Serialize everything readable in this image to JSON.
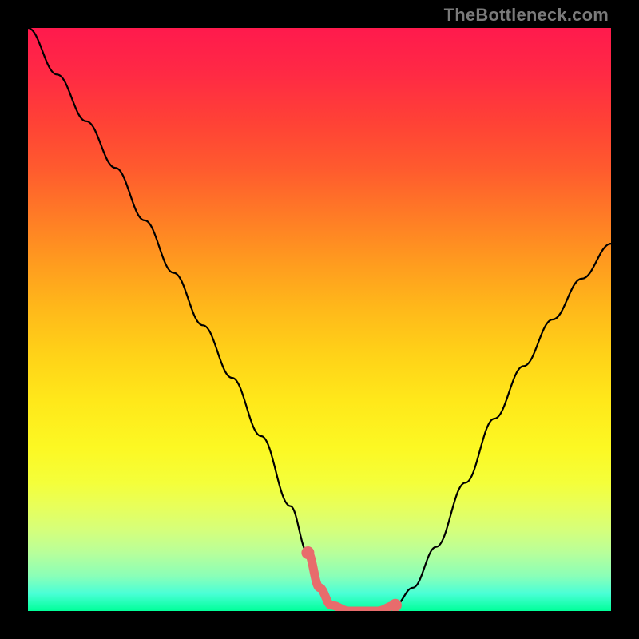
{
  "watermark": "TheBottleneck.com",
  "colors": {
    "background": "#000000",
    "gradient_top": "#ff1a4d",
    "gradient_bottom": "#00ff99",
    "curve": "#000000",
    "highlight": "#e86c6c"
  },
  "chart_data": {
    "type": "line",
    "title": "",
    "xlabel": "",
    "ylabel": "",
    "xlim": [
      0,
      100
    ],
    "ylim": [
      0,
      100
    ],
    "grid": false,
    "legend": false,
    "series": [
      {
        "name": "bottleneck-curve",
        "x": [
          0,
          5,
          10,
          15,
          20,
          25,
          30,
          35,
          40,
          45,
          48,
          50,
          52,
          55,
          58,
          60,
          63,
          66,
          70,
          75,
          80,
          85,
          90,
          95,
          100
        ],
        "y": [
          100,
          92,
          84,
          76,
          67,
          58,
          49,
          40,
          30,
          18,
          10,
          4,
          1,
          0,
          0,
          0,
          1,
          4,
          11,
          22,
          33,
          42,
          50,
          57,
          63
        ]
      }
    ],
    "highlight_region": {
      "x_start": 48,
      "x_end": 63,
      "description": "flat bottom segment of curve"
    }
  }
}
